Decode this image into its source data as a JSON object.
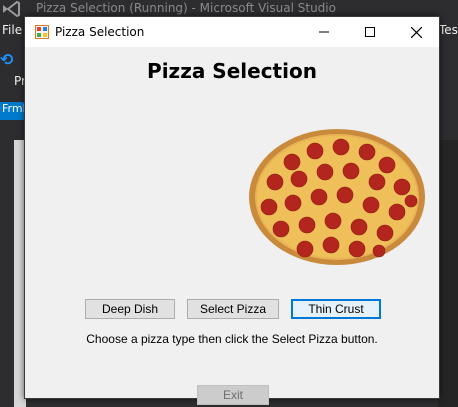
{
  "vs": {
    "title": "Pizza Selection (Running) - Microsoft Visual Studio",
    "menu_file": "File",
    "menu_test": "Test",
    "toolbar_partial": "Pr",
    "doc_tab": "Frml"
  },
  "window": {
    "title": "Pizza Selection",
    "minimize": "—",
    "maximize": "☐",
    "close": "✕"
  },
  "form": {
    "heading": "Pizza Selection",
    "buttons": {
      "deep_dish": "Deep Dish",
      "select_pizza": "Select Pizza",
      "thin_crust": "Thin Crust",
      "exit": "Exit"
    },
    "instructions": "Choose a pizza type then click the Select Pizza button."
  },
  "colors": {
    "vs_background": "#2d2d30",
    "accent": "#0078d7",
    "form_background": "#f0f0f0"
  }
}
